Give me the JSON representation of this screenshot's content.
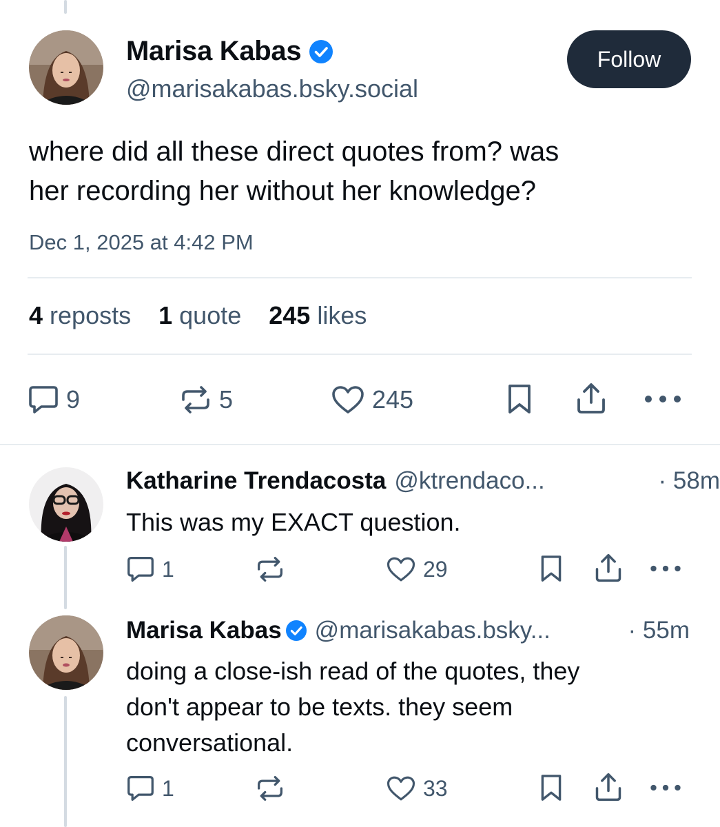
{
  "main_post": {
    "author": {
      "name": "Marisa Kabas",
      "handle": "@marisakabas.bsky.social",
      "verified": true
    },
    "follow_label": "Follow",
    "text_line1": "where did all these direct quotes from? was",
    "text_line2": "her recording her without her knowledge?",
    "timestamp": "Dec 1, 2025 at 4:42 PM",
    "stats": {
      "reposts_count": "4",
      "reposts_label": "reposts",
      "quotes_count": "1",
      "quotes_label": "quote",
      "likes_count": "245",
      "likes_label": "likes"
    },
    "actions": {
      "replies": "9",
      "reposts": "5",
      "likes": "245"
    }
  },
  "replies": [
    {
      "name": "Katharine Trendacosta",
      "handle": "@ktrendaco...",
      "time": "· 58m",
      "text": "This was my EXACT question.",
      "actions": {
        "replies": "1",
        "reposts": "",
        "likes": "29"
      }
    },
    {
      "name": "Marisa Kabas",
      "verified": true,
      "handle": "@marisakabas.bsky...",
      "time": "· 55m",
      "text_line1": "doing a close-ish read of the quotes, they",
      "text_line2": "don't appear to be texts. they seem",
      "text_line3": "conversational.",
      "actions": {
        "replies": "1",
        "reposts": "",
        "likes": "33"
      }
    }
  ],
  "icons": [
    "verified-badge-icon",
    "comment-icon",
    "repost-icon",
    "heart-icon",
    "bookmark-icon",
    "share-icon",
    "more-icon"
  ],
  "colors": {
    "accent": "#1083fe",
    "follow_bg": "#1f2b3a",
    "secondary_text": "#42576c",
    "divider": "#e7ecf0"
  }
}
